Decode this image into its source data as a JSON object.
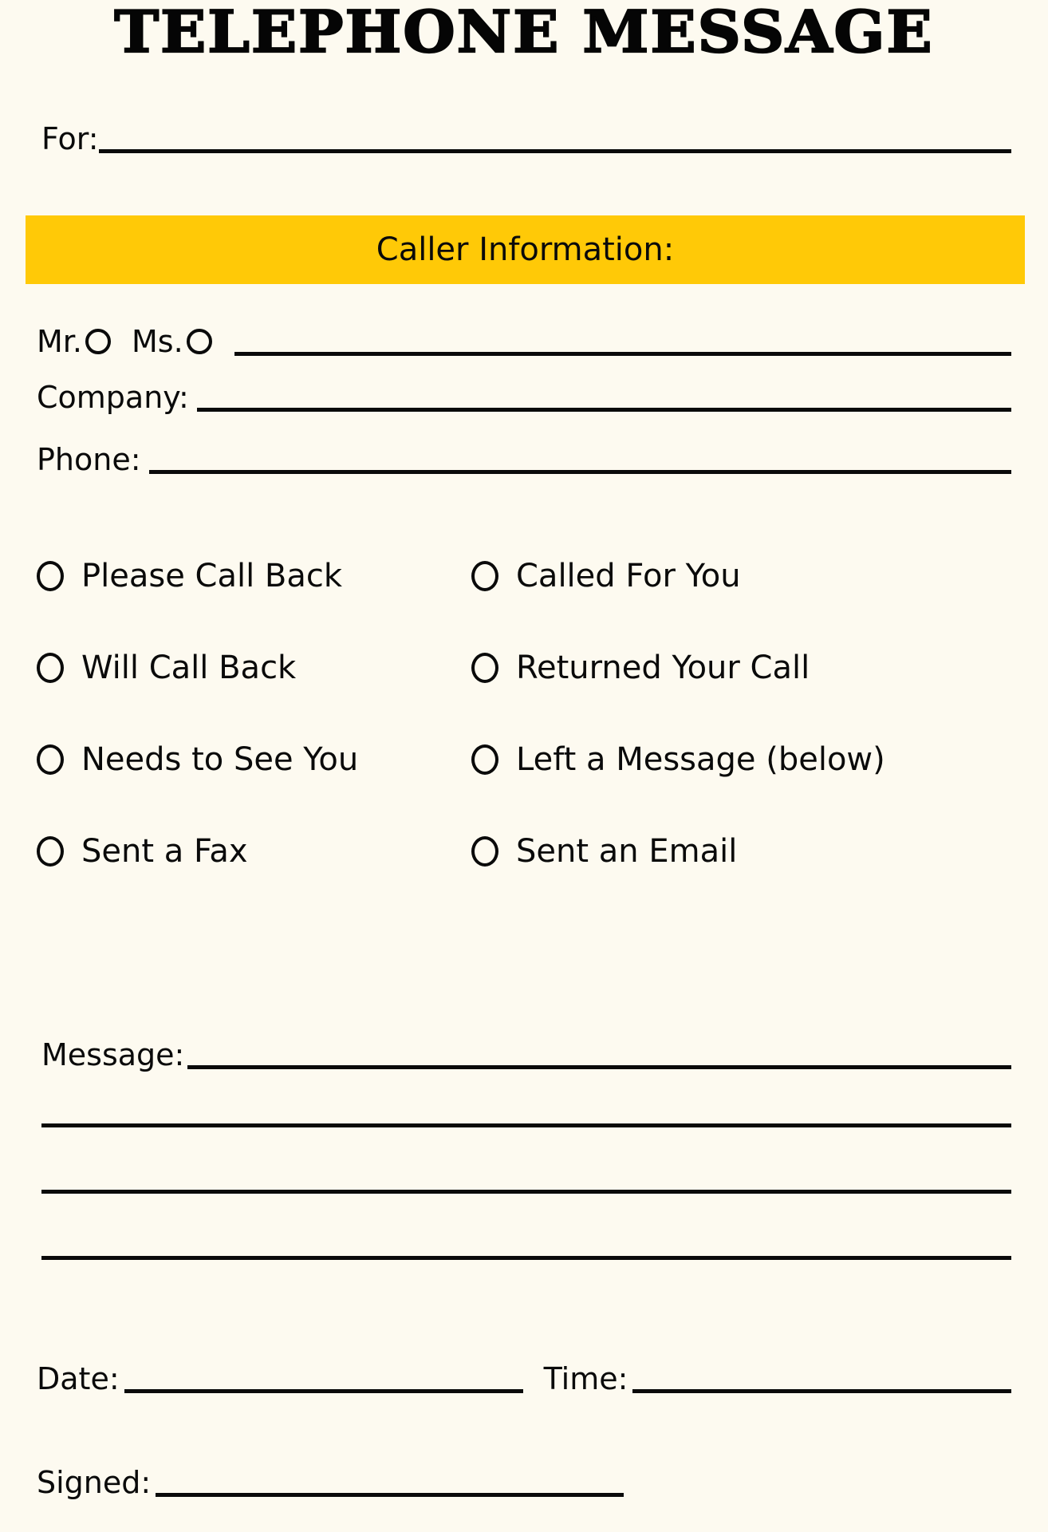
{
  "document": {
    "title": "TELEPHONE  MESSAGE",
    "background_color": "#FDFAF0",
    "accent_color": "#FFC907",
    "ink_color": "#0A0A0A"
  },
  "recipient": {
    "label": "For:",
    "value": "",
    "placeholder": ""
  },
  "caller_section": {
    "banner_label": "Caller Information:",
    "salutation": {
      "options": [
        {
          "label": "Mr.",
          "name": "mr",
          "selected": false
        },
        {
          "label": "Ms.",
          "name": "ms",
          "selected": false
        }
      ],
      "name_value": "",
      "name_placeholder": ""
    },
    "fields": [
      {
        "label": "Company:",
        "value": "",
        "placeholder": "",
        "name": "company"
      },
      {
        "label": "Phone:",
        "value": "",
        "placeholder": "",
        "name": "phone"
      }
    ]
  },
  "call_actions": {
    "rows": [
      {
        "left": {
          "label": "Please Call Back",
          "name": "please-call-back",
          "checked": false
        },
        "right": {
          "label": "Called For You",
          "name": "called-for-you",
          "checked": false
        }
      },
      {
        "left": {
          "label": "Will Call Back",
          "name": "will-call-back",
          "checked": false
        },
        "right": {
          "label": "Returned Your Call",
          "name": "returned-your-call",
          "checked": false
        }
      },
      {
        "left": {
          "label": "Needs to See You",
          "name": "needs-to-see-you",
          "checked": false
        },
        "right": {
          "label": "Left a Message (below)",
          "name": "left-a-message",
          "checked": false
        }
      },
      {
        "left": {
          "label": "Sent a Fax",
          "name": "sent-a-fax",
          "checked": false
        },
        "right": {
          "label": "Sent an Email",
          "name": "sent-an-email",
          "checked": false
        }
      }
    ]
  },
  "message_section": {
    "label": "Message:",
    "value": "",
    "placeholder": "",
    "blank_line_count": 3
  },
  "footer": {
    "date": {
      "label": "Date:",
      "value": "",
      "placeholder": ""
    },
    "time": {
      "label": "Time:",
      "value": "",
      "placeholder": ""
    },
    "signed": {
      "label": "Signed:",
      "value": "",
      "placeholder": ""
    }
  }
}
